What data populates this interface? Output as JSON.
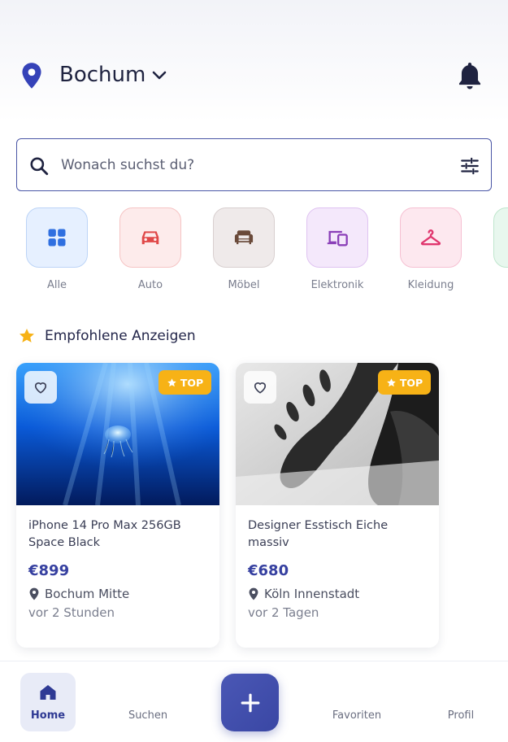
{
  "header": {
    "city": "Bochum",
    "location_icon": "location-pin-icon",
    "dropdown_icon": "chevron-down-icon",
    "notifications_icon": "bell-icon"
  },
  "search": {
    "placeholder": "Wonach suchst du?",
    "value": "",
    "search_icon": "search-icon",
    "filter_icon": "filter-sliders-icon"
  },
  "categories": [
    {
      "label": "Alle",
      "icon": "grid-icon",
      "color": "#2f6fe0",
      "bg": "#e6f0ff",
      "border": "#bcd4f7"
    },
    {
      "label": "Auto",
      "icon": "car-icon",
      "color": "#e04848",
      "bg": "#fdebeb",
      "border": "#f6c4c4"
    },
    {
      "label": "Möbel",
      "icon": "sofa-icon",
      "color": "#6a4a3a",
      "bg": "#efeaea",
      "border": "#d8cfcf"
    },
    {
      "label": "Elektronik",
      "icon": "devices-icon",
      "color": "#8a3fb8",
      "bg": "#f4e8fb",
      "border": "#dfc3f1"
    },
    {
      "label": "Kleidung",
      "icon": "hanger-icon",
      "color": "#e0366e",
      "bg": "#fde8ef",
      "border": "#f6c0d2"
    },
    {
      "label": "",
      "icon": "more-category-icon",
      "color": "#3aa864",
      "bg": "#e8f7ee",
      "border": "#bfe6cd"
    }
  ],
  "featured": {
    "title": "Empfohlene Anzeigen",
    "icon": "star-icon",
    "icon_color": "#f7b216"
  },
  "listings": [
    {
      "title": "iPhone 14 Pro Max 256GB Space Black",
      "price": "€899",
      "location": "Bochum Mitte",
      "time": "vor 2 Stunden",
      "badge": "TOP",
      "image": "jellyfish-underwater-image"
    },
    {
      "title": "Designer Esstisch Eiche massiv",
      "price": "€680",
      "location": "Köln Innenstadt",
      "time": "vor 2 Tagen",
      "badge": "TOP",
      "image": "bare-feet-bw-image"
    }
  ],
  "nav": {
    "items": [
      {
        "label": "Home",
        "icon": "home-icon",
        "active": true
      },
      {
        "label": "Suchen",
        "icon": "search-icon",
        "active": false
      },
      {
        "label": "Favoriten",
        "icon": "heart-icon",
        "active": false
      },
      {
        "label": "Profil",
        "icon": "user-icon",
        "active": false
      }
    ],
    "fab_icon": "plus-icon",
    "accent": "#3a47a4"
  }
}
